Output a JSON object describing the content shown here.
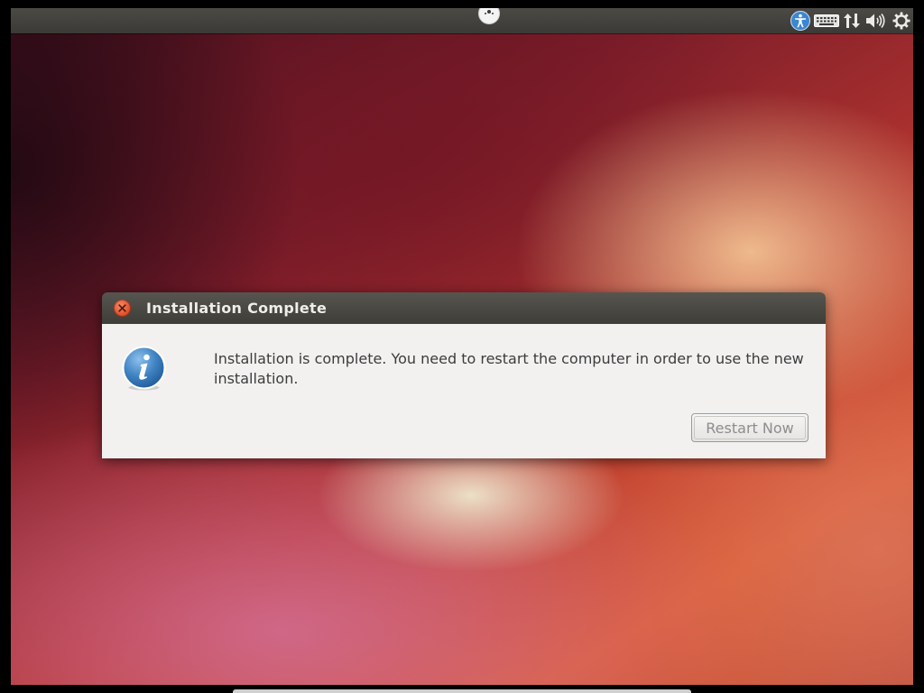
{
  "desktop": {
    "panel_indicators": [
      "universal-access-icon",
      "keyboard-icon",
      "network-icon",
      "sound-icon",
      "session-gear-icon"
    ]
  },
  "dialog": {
    "title": "Installation Complete",
    "message": "Installation is complete. You need to restart the computer in order to use the new installation.",
    "restart_button_label": "Restart Now",
    "icon": "info-icon"
  },
  "colors": {
    "panel": "#3c3b37",
    "close_button": "#e0542e",
    "dialog_body": "#f2f1f0",
    "info_icon": "#3d7fbd"
  }
}
